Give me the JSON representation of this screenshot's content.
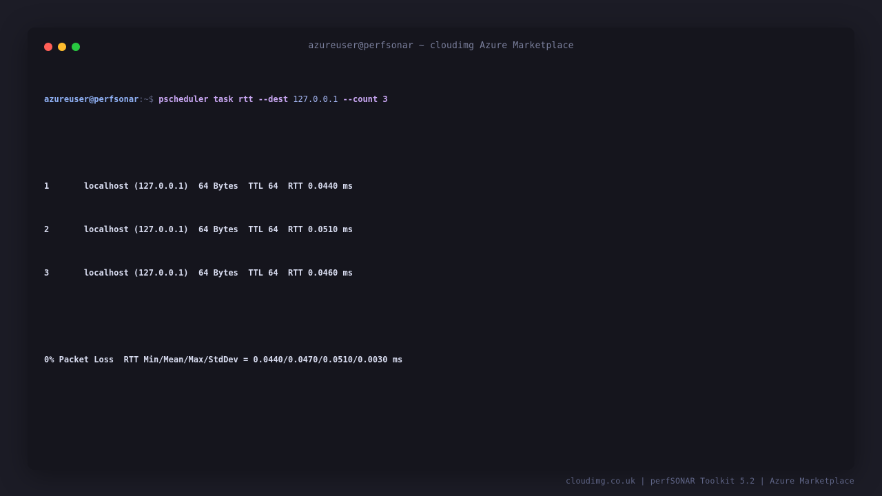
{
  "window": {
    "title": "azureuser@perfsonar ~ cloudimg Azure Marketplace",
    "controls": [
      {
        "name": "close",
        "color": "#ff5f57"
      },
      {
        "name": "minimize",
        "color": "#febc2e"
      },
      {
        "name": "maximize",
        "color": "#28c840"
      }
    ]
  },
  "terminal": {
    "prompt_user": "azureuser@perfsonar",
    "prompt_path": ":~$",
    "command": "pscheduler task rtt --dest",
    "command_arg": "127.0.0.1",
    "command_count": "--count 3",
    "results": [
      {
        "seq": "1",
        "text": "localhost (127.0.0.1)  64 Bytes  TTL 64  RTT 0.0440 ms"
      },
      {
        "seq": "2",
        "text": "localhost (127.0.0.1)  64 Bytes  TTL 64  RTT 0.0510 ms"
      },
      {
        "seq": "3",
        "text": "localhost (127.0.0.1)  64 Bytes  TTL 64  RTT 0.0460 ms"
      }
    ],
    "summary": "0% Packet Loss  RTT Min/Mean/Max/StdDev = 0.0440/0.0470/0.0510/0.0030 ms"
  },
  "footer": {
    "text": "cloudimg.co.uk | perfSONAR Toolkit 5.2 | Azure Marketplace"
  },
  "colors": {
    "background": "#1c1c26",
    "window": "#15151d",
    "prompt_user": "#8fb0f4",
    "command": "#c8a6f2",
    "output": "#d8dcf0"
  }
}
